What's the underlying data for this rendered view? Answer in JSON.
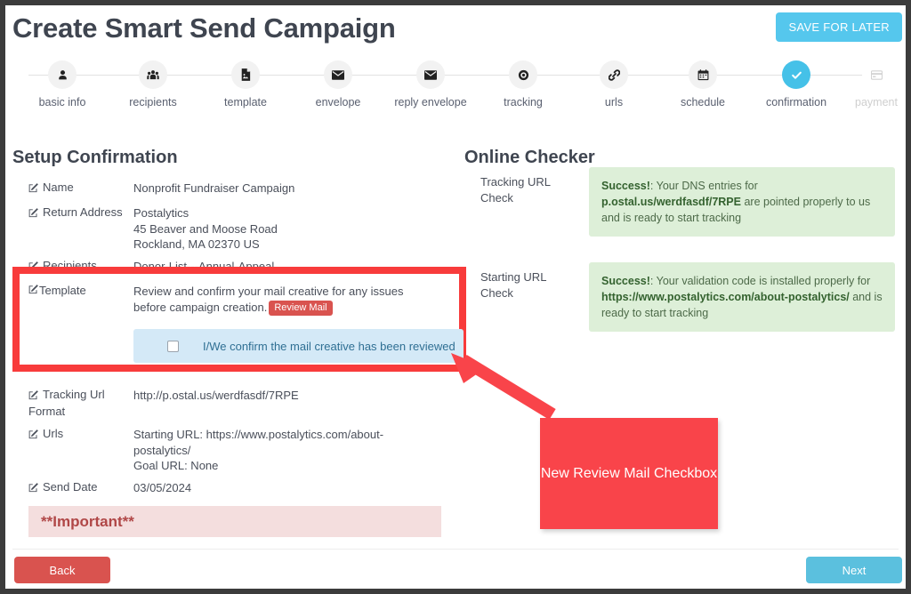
{
  "header": {
    "title": "Create Smart Send Campaign",
    "save_for_later_label": "SAVE FOR LATER",
    "accent_blue": "#55c7ed"
  },
  "stepper": {
    "steps": [
      {
        "label": "basic info",
        "icon": "user-icon",
        "state": "done"
      },
      {
        "label": "recipients",
        "icon": "users-icon",
        "state": "done"
      },
      {
        "label": "template",
        "icon": "file-image-icon",
        "state": "done"
      },
      {
        "label": "envelope",
        "icon": "envelope-icon",
        "state": "done"
      },
      {
        "label": "reply envelope",
        "icon": "envelope-icon",
        "state": "done"
      },
      {
        "label": "tracking",
        "icon": "target-icon",
        "state": "done"
      },
      {
        "label": "urls",
        "icon": "link-icon",
        "state": "done"
      },
      {
        "label": "schedule",
        "icon": "calendar-icon",
        "state": "done"
      },
      {
        "label": "confirmation",
        "icon": "check-icon",
        "state": "active"
      },
      {
        "label": "payment",
        "icon": "credit-card-icon",
        "state": "disabled"
      }
    ],
    "active_color": "#45c1e8"
  },
  "setup": {
    "heading": "Setup Confirmation",
    "rows": [
      {
        "label": "Name",
        "value": "Nonprofit Fundraiser Campaign"
      },
      {
        "label": "Return Address",
        "value": "Postalytics\n45 Beaver and Moose Road\nRockland, MA 02370 US"
      },
      {
        "label": "Recipients",
        "value": "Donor-List---Annual-Appeal"
      },
      {
        "label": "Tracking Url Format",
        "value": "http://p.ostal.us/werdfasdf/7RPE"
      },
      {
        "label": "Urls",
        "value": "Starting URL: https://www.postalytics.com/about-postalytics/\nGoal URL: None"
      },
      {
        "label": "Send Date",
        "value": "03/05/2024"
      }
    ],
    "template": {
      "label": "Template",
      "text": "Review and confirm your mail creative for any issues before campaign creation.",
      "badge_label": "Review Mail",
      "badge_color": "#d9534f",
      "checkbox_label": "I/We confirm the mail creative has been reviewed",
      "checkbox_checked": false,
      "panel_color": "#d4e9f7"
    },
    "important": {
      "text": "**Important**",
      "background": "#f4dede",
      "text_color": "#b04747"
    }
  },
  "checker": {
    "heading": "Online Checker",
    "rows": [
      {
        "label": "Tracking URL Check",
        "status": "Success!",
        "message_pre": ": Your DNS entries for ",
        "highlight": "p.ostal.us/werdfasdf/7RPE",
        "message_post": " are pointed properly to us and is ready to start tracking"
      },
      {
        "label": "Starting URL Check",
        "status": "Success!",
        "message_pre": ": Your validation code is installed properly for ",
        "highlight": "https://www.postalytics.com/about-postalytics/",
        "message_post": " and is ready to start tracking"
      }
    ],
    "success_background": "#ddefd8"
  },
  "annotation": {
    "text": "New Review Mail Checkbox",
    "color": "#f9444a",
    "highlight_border_color": "#f83b3b"
  },
  "footer": {
    "back_label": "Back",
    "next_label": "Next",
    "back_color": "#d9534f",
    "next_color": "#5bc0de"
  }
}
